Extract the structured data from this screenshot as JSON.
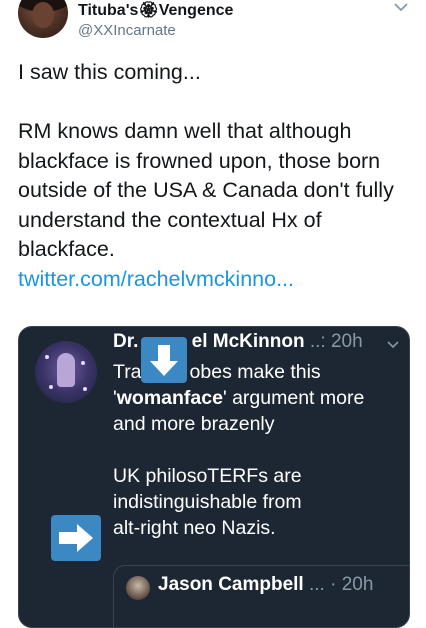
{
  "tweet": {
    "author": {
      "display_name": "Tituba's🏵Vengence",
      "handle": "@XXIncarnate"
    },
    "paragraphs": [
      "I saw this coming...",
      "RM knows damn well that although blackface is frowned upon, those born outside of the USA & Canada don't fully understand the contextual Hx of blackface."
    ],
    "link": "twitter.com/rachelvmckinno..."
  },
  "quoted": {
    "name": "Dr. Rachel McKinnon",
    "name_visible_start": "Dr. ",
    "name_visible_end": "el McKinnon",
    "meta": "..: 20h",
    "line1_start": "Tra",
    "line1_end": "obes make this",
    "emphasis": "womanface",
    "line2_rest": "' argument more",
    "line3": "and more brazenly",
    "para2": [
      "UK philosoTERFs are",
      "indistinguishable from",
      "alt-right neo Nazis."
    ],
    "inner": {
      "name": "Jason Campbell",
      "meta": "... · 20h"
    }
  },
  "icons": [
    "chevron-down-icon",
    "down-arrow-emoji",
    "right-arrow-emoji"
  ],
  "colors": {
    "link": "#1b95e0",
    "card_bg": "#1d2733",
    "arrow_emoji": "#3b88c3"
  }
}
